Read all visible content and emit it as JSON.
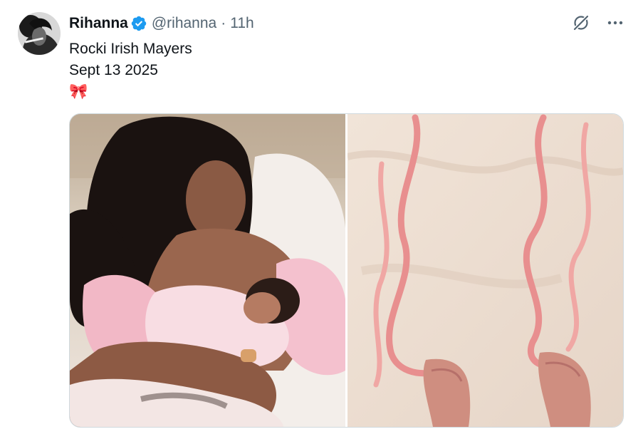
{
  "author": {
    "name": "Rihanna",
    "handle": "@rihanna",
    "separator": "·",
    "time": "11h",
    "verified": true,
    "verified_color": "#1d9bf0"
  },
  "tweet": {
    "lines": [
      "Rocki Irish Mayers",
      "Sept 13 2025"
    ],
    "emoji": "🎀"
  },
  "media": [
    {
      "kind": "photo",
      "subject": "mother-holding-newborn"
    },
    {
      "kind": "photo",
      "subject": "pink-ribbons-baby-booties"
    }
  ],
  "icons": {
    "grok": "grok-icon",
    "more": "more-icon",
    "verified": "verified-badge-icon"
  },
  "colors": {
    "text": "#0f1419",
    "secondary": "#536471",
    "border": "#cfd9de",
    "accent": "#1d9bf0"
  }
}
